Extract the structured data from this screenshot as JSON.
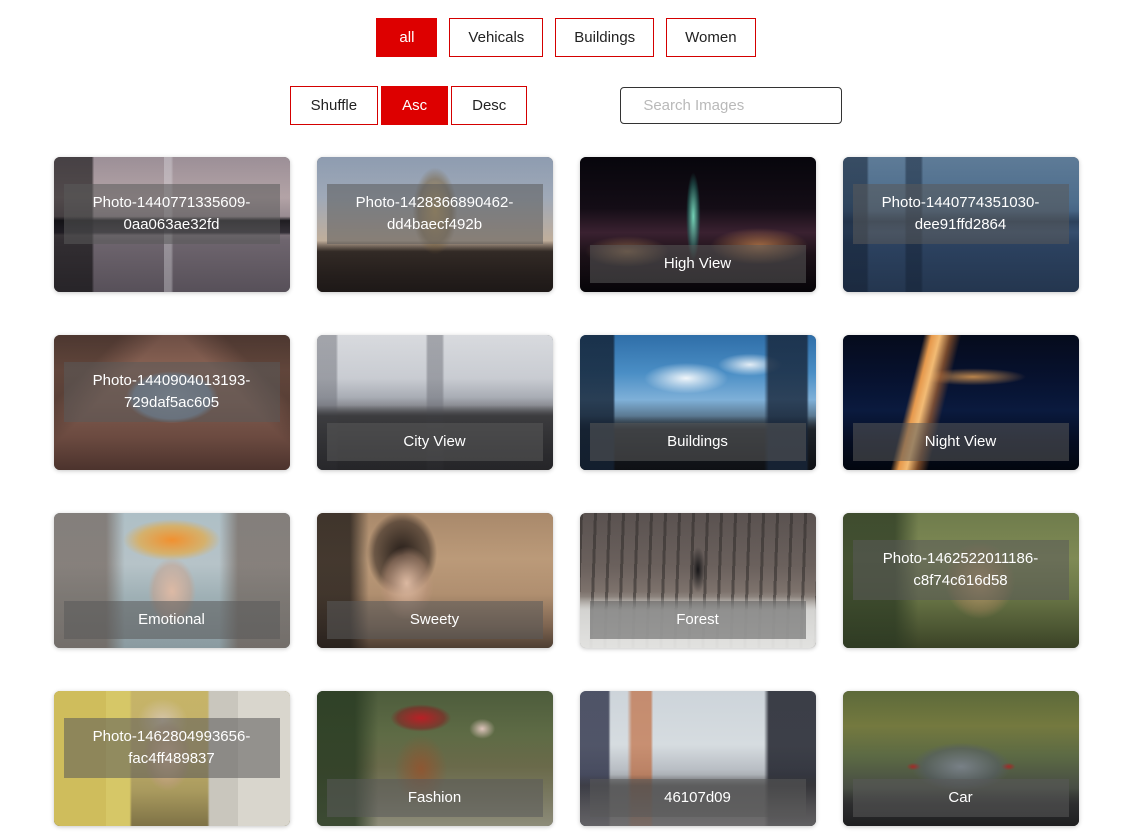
{
  "theme": {
    "accent": "#dd0000",
    "accent_border": "#d40000",
    "page_background": "#ffffff",
    "caption_text": "#ffffff"
  },
  "filters": {
    "items": [
      {
        "label": "all",
        "active": true
      },
      {
        "label": "Vehicals",
        "active": false
      },
      {
        "label": "Buildings",
        "active": false
      },
      {
        "label": "Women",
        "active": false
      }
    ]
  },
  "sort": {
    "items": [
      {
        "label": "Shuffle",
        "active": false
      },
      {
        "label": "Asc",
        "active": true
      },
      {
        "label": "Desc",
        "active": false
      }
    ]
  },
  "search": {
    "placeholder": "Search Images",
    "value": ""
  },
  "gallery": {
    "items": [
      {
        "caption": "Photo-1440771335609-0aa063ae32fd",
        "lines": 3
      },
      {
        "caption": "Photo-1428366890462-dd4baecf492b",
        "lines": 3
      },
      {
        "caption": "High View",
        "lines": 1
      },
      {
        "caption": "Photo-1440774351030-dee91ffd2864",
        "lines": 3
      },
      {
        "caption": "Photo-1440904013193-729daf5ac605",
        "lines": 3
      },
      {
        "caption": "City View",
        "lines": 1
      },
      {
        "caption": "Buildings",
        "lines": 1
      },
      {
        "caption": "Night View",
        "lines": 1
      },
      {
        "caption": "Emotional",
        "lines": 1
      },
      {
        "caption": "Sweety",
        "lines": 1
      },
      {
        "caption": "Forest",
        "lines": 1
      },
      {
        "caption": "Photo-1462522011186-c8f74c616d58",
        "lines": 3
      },
      {
        "caption": "Photo-1462804993656-fac4ff489837",
        "lines": 3
      },
      {
        "caption": "Fashion",
        "lines": 1
      },
      {
        "caption": "46107d09",
        "lines": 1
      },
      {
        "caption": "Car",
        "lines": 1
      }
    ]
  }
}
